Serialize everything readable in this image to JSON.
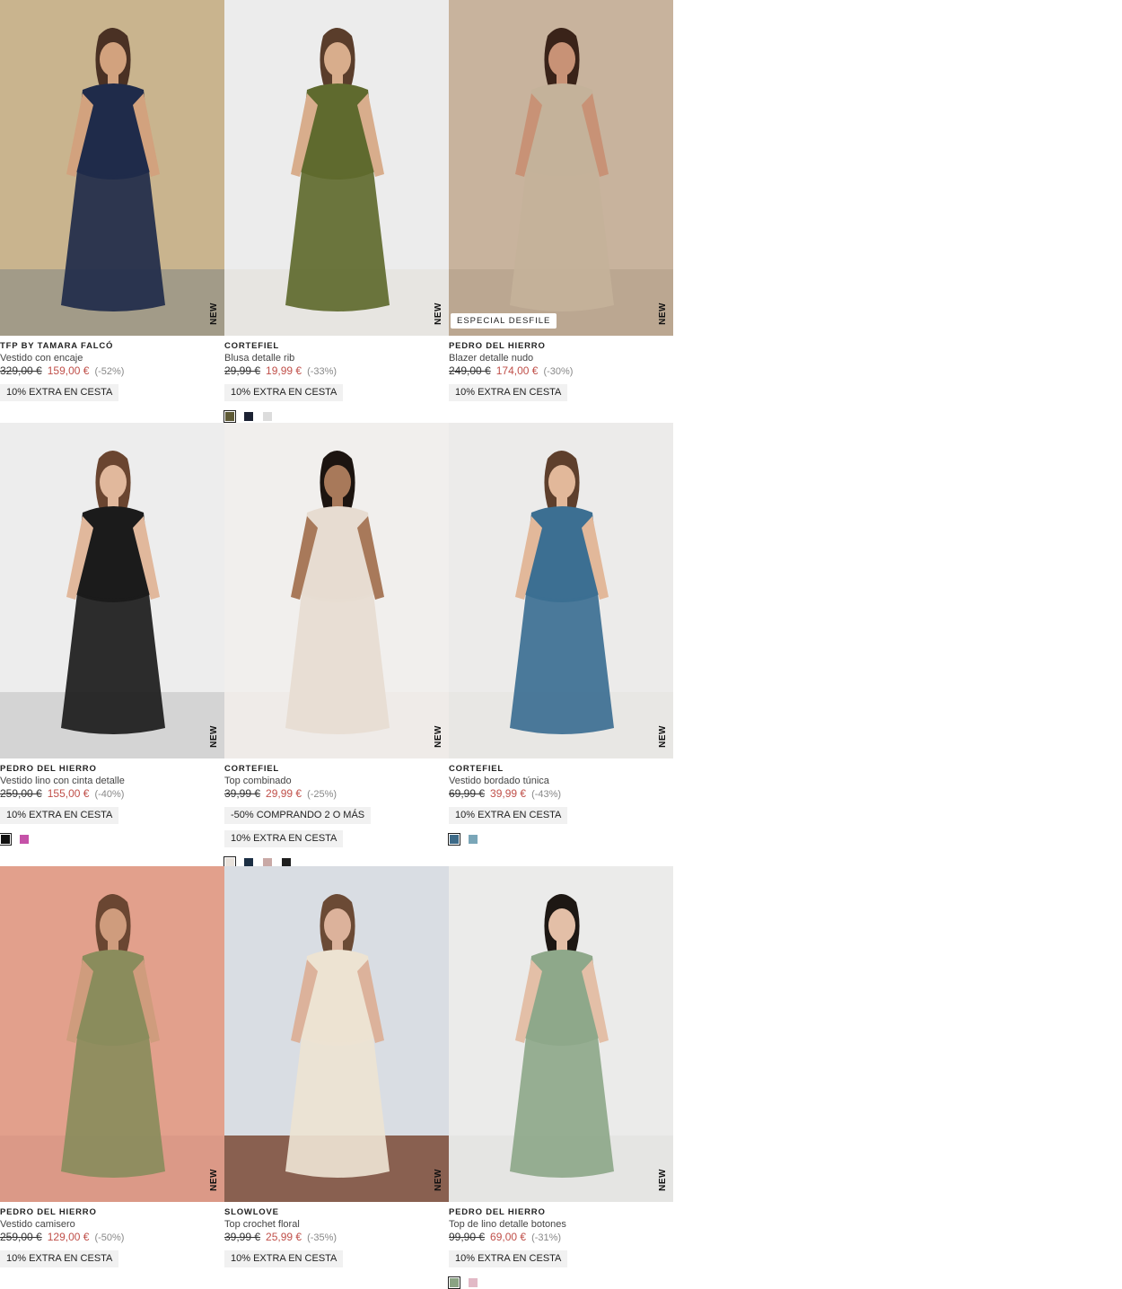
{
  "products": [
    {
      "brand": "TFP BY TAMARA FALCÓ",
      "title": "Vestido con encaje",
      "old_price": "329,00 €",
      "price": "159,00 €",
      "discount": "(-52%)",
      "new_label": "NEW",
      "badge": "",
      "promos": [
        "10% EXTRA EN CESTA"
      ],
      "swatches": [],
      "bg": "#c9b48e",
      "garment": "#1f2b4a",
      "skin": "#d2a27e",
      "hair": "#4a3124",
      "floor": "#9b9687"
    },
    {
      "brand": "CORTEFIEL",
      "title": "Blusa detalle rib",
      "old_price": "29,99 €",
      "price": "19,99 €",
      "discount": "(-33%)",
      "new_label": "NEW",
      "badge": "",
      "promos": [
        "10% EXTRA EN CESTA"
      ],
      "swatches": [
        "#5e5a36",
        "#1c2233",
        "#dcdcdc"
      ],
      "bg": "#ececec",
      "garment": "#5f6a2e",
      "skin": "#d8ad8c",
      "hair": "#5a3d2b",
      "floor": "#e6e4df"
    },
    {
      "brand": "PEDRO DEL HIERRO",
      "title": "Blazer detalle nudo",
      "old_price": "249,00 €",
      "price": "174,00 €",
      "discount": "(-30%)",
      "new_label": "NEW",
      "badge": "ESPECIAL DESFILE",
      "promos": [
        "10% EXTRA EN CESTA"
      ],
      "swatches": [],
      "bg": "#c8b39d",
      "garment": "#c4b29a",
      "skin": "#c89276",
      "hair": "#3a2319",
      "floor": "#b9a58f"
    },
    {
      "brand": "PEDRO DEL HIERRO",
      "title": "Vestido lino con cinta detalle",
      "old_price": "259,00 €",
      "price": "155,00 €",
      "discount": "(-40%)",
      "new_label": "NEW",
      "badge": "",
      "promos": [
        "10% EXTRA EN CESTA"
      ],
      "swatches": [
        "#111111",
        "#c552a8"
      ],
      "bg": "#ededed",
      "garment": "#1b1b1b",
      "skin": "#e1b89c",
      "hair": "#6a4530",
      "floor": "#cfcfcf"
    },
    {
      "brand": "CORTEFIEL",
      "title": "Top combinado",
      "old_price": "39,99 €",
      "price": "29,99 €",
      "discount": "(-25%)",
      "new_label": "NEW",
      "badge": "",
      "promos": [
        "-50% COMPRANDO 2 O MÁS",
        "10% EXTRA EN CESTA"
      ],
      "swatches": [
        "#e8e2dc",
        "#1c2f44",
        "#c9a9a6",
        "#1e1e1e"
      ],
      "bg": "#f1efed",
      "garment": "#e7dcd1",
      "skin": "#a8795a",
      "hair": "#1c1410",
      "floor": "#eeeae6"
    },
    {
      "brand": "CORTEFIEL",
      "title": "Vestido bordado túnica",
      "old_price": "69,99 €",
      "price": "39,99 €",
      "discount": "(-43%)",
      "new_label": "NEW",
      "badge": "",
      "promos": [
        "10% EXTRA EN CESTA"
      ],
      "swatches": [
        "#3d6a88",
        "#7aa6b8"
      ],
      "bg": "#ecebea",
      "garment": "#3c6f92",
      "skin": "#e2b89a",
      "hair": "#5e3f2c",
      "floor": "#e8e6e3"
    },
    {
      "brand": "PEDRO DEL HIERRO",
      "title": "Vestido camisero",
      "old_price": "259,00 €",
      "price": "129,00 €",
      "discount": "(-50%)",
      "new_label": "NEW",
      "badge": "",
      "promos": [
        "10% EXTRA EN CESTA"
      ],
      "swatches": [],
      "bg": "#e2a08c",
      "garment": "#8a8c5c",
      "skin": "#cf9c7d",
      "hair": "#6a4632",
      "floor": "#d99886"
    },
    {
      "brand": "SLOWLOVE",
      "title": "Top crochet floral",
      "old_price": "39,99 €",
      "price": "25,99 €",
      "discount": "(-35%)",
      "new_label": "NEW",
      "badge": "",
      "promos": [
        "10% EXTRA EN CESTA"
      ],
      "swatches": [],
      "bg": "#d9dde3",
      "garment": "#ede3d2",
      "skin": "#dcb29b",
      "hair": "#6b4a35",
      "floor": "#7a4a36"
    },
    {
      "brand": "PEDRO DEL HIERRO",
      "title": "Top de lino detalle botones",
      "old_price": "99,90 €",
      "price": "69,00 €",
      "discount": "(-31%)",
      "new_label": "NEW",
      "badge": "",
      "promos": [
        "10% EXTRA EN CESTA"
      ],
      "swatches": [
        "#8aa383",
        "#e2b9c6"
      ],
      "bg": "#ebebea",
      "garment": "#8ea88a",
      "skin": "#e3bfa7",
      "hair": "#1d1713",
      "floor": "#e4e4e2"
    }
  ]
}
